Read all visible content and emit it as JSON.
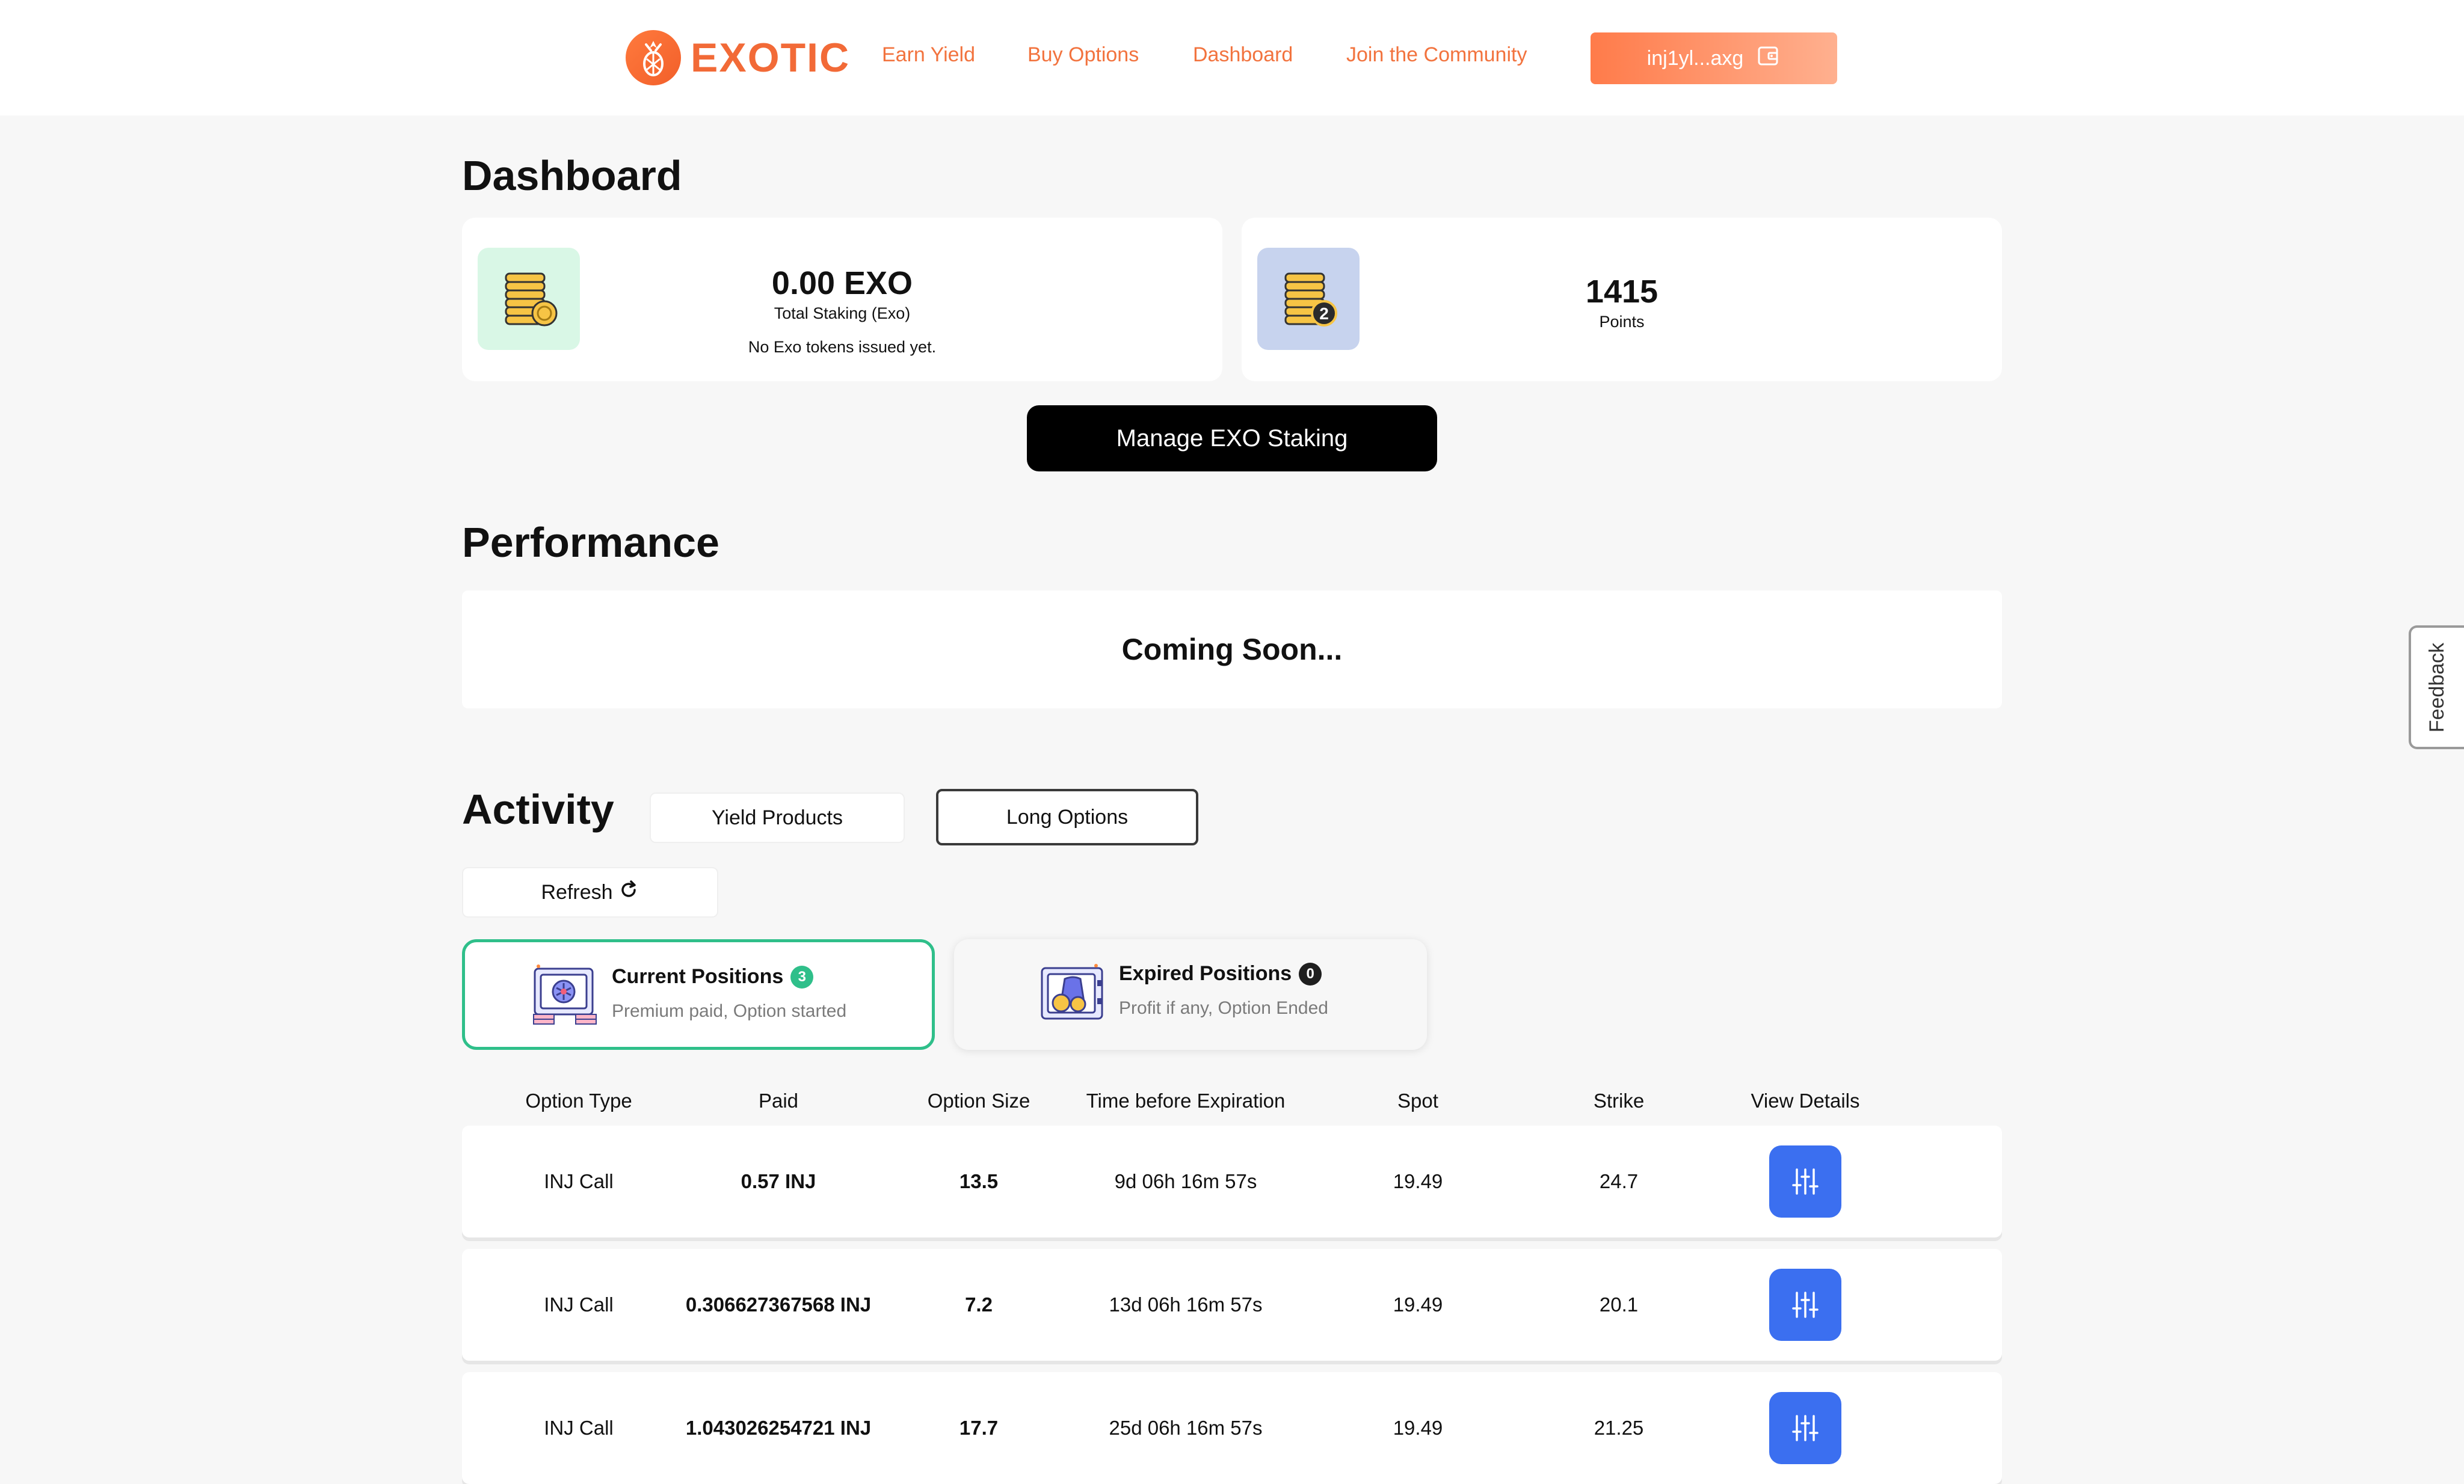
{
  "header": {
    "brand": "EXOTIC",
    "nav": [
      "Earn Yield",
      "Buy Options",
      "Dashboard",
      "Join the Community"
    ],
    "wallet_label": "inj1yl...axg"
  },
  "dashboard": {
    "title": "Dashboard",
    "staking": {
      "value": "0.00 EXO",
      "label": "Total Staking (Exo)",
      "note": "No Exo tokens issued yet."
    },
    "points": {
      "value": "1415",
      "label": "Points",
      "badge": "2"
    },
    "manage_button": "Manage EXO Staking"
  },
  "performance": {
    "title": "Performance",
    "message": "Coming Soon..."
  },
  "activity": {
    "title": "Activity",
    "tabs": [
      "Yield Products",
      "Long Options"
    ],
    "active_tab": "Long Options",
    "refresh_label": "Refresh",
    "current": {
      "title": "Current Positions",
      "count": "3",
      "subtitle": "Premium paid, Option started"
    },
    "expired": {
      "title": "Expired Positions",
      "count": "0",
      "subtitle": "Profit if any, Option Ended"
    },
    "table": {
      "columns": [
        "Option Type",
        "Paid",
        "Option Size",
        "Time before Expiration",
        "Spot",
        "Strike",
        "View Details"
      ],
      "rows": [
        {
          "type": "INJ Call",
          "paid": "0.57 INJ",
          "size": "13.5",
          "time": "9d 06h 16m 57s",
          "spot": "19.49",
          "strike": "24.7"
        },
        {
          "type": "INJ Call",
          "paid": "0.306627367568 INJ",
          "size": "7.2",
          "time": "13d 06h 16m 57s",
          "spot": "19.49",
          "strike": "20.1"
        },
        {
          "type": "INJ Call",
          "paid": "1.043026254721 INJ",
          "size": "17.7",
          "time": "25d 06h 16m 57s",
          "spot": "19.49",
          "strike": "21.25"
        }
      ]
    }
  },
  "feedback_label": "Feedback",
  "colors": {
    "brand_orange": "#f26a37",
    "accent_green": "#2fbf8a",
    "detail_blue": "#3b6ff0"
  }
}
